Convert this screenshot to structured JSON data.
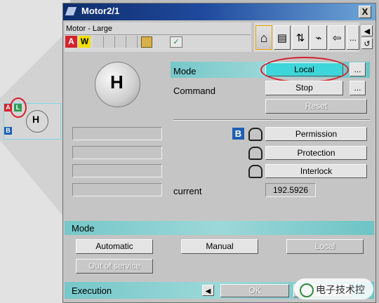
{
  "mini_faceplate": {
    "badge_a": "A",
    "badge_b": "B",
    "badge_l": "L",
    "symbol": "H"
  },
  "window": {
    "title": "Motor2/1",
    "close_glyph": "X",
    "device_name": "Motor - Large",
    "flags": {
      "a": "A",
      "w": "W"
    },
    "toolbar_icons": [
      "home-icon",
      "document-icon",
      "scale-icon",
      "trend-icon",
      "back-icon",
      "more-icon",
      "speaker-icon",
      "undo-icon"
    ],
    "more_label": "...",
    "motor_symbol": "H",
    "mode_label": "Mode",
    "mode_value": "Local",
    "command_label": "Command",
    "command_value": "Stop",
    "reset_label": "Reset",
    "b_badge": "B",
    "permission_label": "Permission",
    "protection_label": "Protection",
    "interlock_label": "Interlock",
    "current_label": "current",
    "current_value": "192.5926",
    "mode_section_title": "Mode",
    "automatic_label": "Automatic",
    "manual_label": "Manual",
    "local_label": "Local",
    "out_of_service_label": "Out of service",
    "execution_label": "Execution",
    "ok_label": "OK",
    "watermark": "电子技术控"
  },
  "colors": {
    "title_bar_start": "#0f2d6a",
    "accent_teal": "#3ed6da",
    "highlight_red": "#d81f2a",
    "a_flag": "#d3232d",
    "w_flag": "#f1df00",
    "b_badge": "#1e5fb3"
  }
}
